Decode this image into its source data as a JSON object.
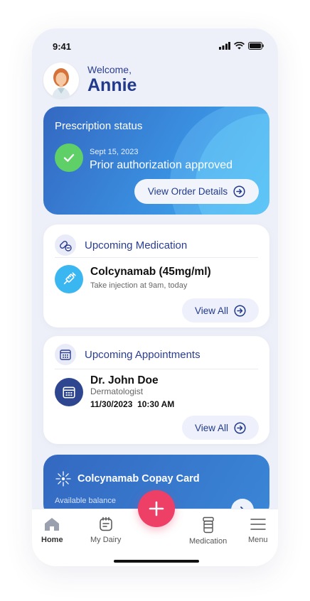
{
  "status_bar": {
    "time": "9:41"
  },
  "header": {
    "welcome": "Welcome,",
    "name": "Annie"
  },
  "prescription": {
    "title": "Prescription status",
    "date": "Sept 15, 2023",
    "status": "Prior authorization approved",
    "button_label": "View Order Details"
  },
  "medication": {
    "title": "Upcoming Medication",
    "item_name": "Colcynamab (45mg/ml)",
    "item_detail": "Take injection at 9am, today",
    "button_label": "View All"
  },
  "appointments": {
    "title": "Upcoming Appointments",
    "doctor": "Dr. John Doe",
    "specialty": "Dermatologist",
    "datetime": "11/30/2023  10:30 AM",
    "button_label": "View All"
  },
  "copay": {
    "title": "Colcynamab Copay Card",
    "subtitle": "Available balance"
  },
  "tabbar": {
    "items": [
      {
        "label": "Home",
        "icon": "home-icon"
      },
      {
        "label": "My Dairy",
        "icon": "diary-icon"
      },
      {
        "label": "Medication",
        "icon": "pill-bottle-icon"
      },
      {
        "label": "Menu",
        "icon": "menu-icon"
      }
    ]
  },
  "colors": {
    "accent": "#213a8c",
    "fab": "#ee3f67",
    "success": "#5fcf68",
    "card_blue": "#3a8fe0"
  }
}
